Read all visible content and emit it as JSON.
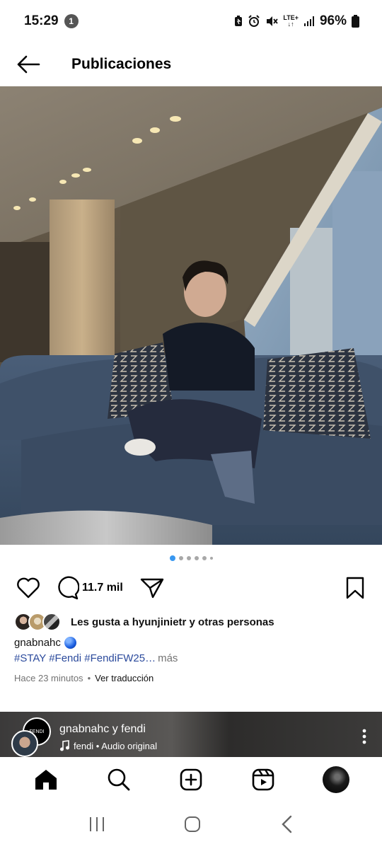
{
  "status_bar": {
    "time": "15:29",
    "notification_count": "1",
    "network": "LTE+",
    "battery": "96%"
  },
  "header": {
    "title": "Publicaciones"
  },
  "carousel": {
    "total": 6,
    "active_index": 0
  },
  "actions": {
    "comment_count": "11.7 mil"
  },
  "likes": {
    "text": "Les gusta a hyunjinietr y otras personas"
  },
  "caption": {
    "username": "gnabnahc",
    "hashtags": "#STAY #Fendi #FendiFW25…",
    "more_label": "más",
    "time_ago": "Hace 23 minutos",
    "separator": "•",
    "translate_label": "Ver traducción"
  },
  "next_post": {
    "users": "gnabnahc y fendi",
    "audio": "fendi • Audio original",
    "logo_text": "FENDI"
  },
  "bottom_nav": [
    "home-icon",
    "search-icon",
    "create-icon",
    "reels-icon",
    "profile"
  ],
  "colors": {
    "accent": "#3897f0",
    "hashtag": "#2b4a9c",
    "muted": "#737373"
  }
}
